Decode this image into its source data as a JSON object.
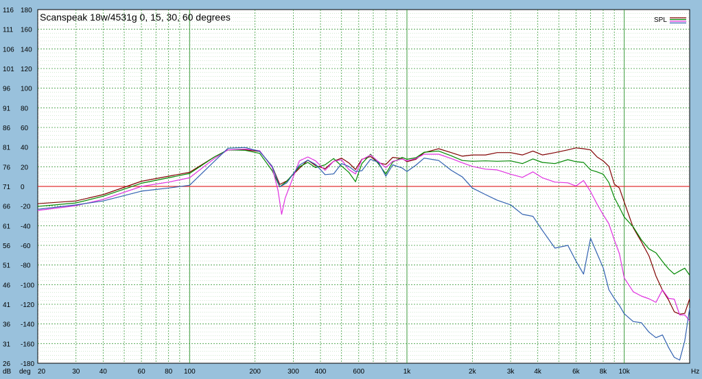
{
  "chart_data": {
    "type": "line",
    "title": "Scanspeak 18w/4531g 0, 15, 30, 60 degrees",
    "legend_label": "SPL",
    "legend_position": "top-right",
    "x_scale": "log",
    "xlim": [
      20,
      20000
    ],
    "x_unit": "Hz",
    "x_ticks": [
      {
        "v": 20,
        "label": "20"
      },
      {
        "v": 30,
        "label": "30"
      },
      {
        "v": 40,
        "label": "40"
      },
      {
        "v": 60,
        "label": "60"
      },
      {
        "v": 80,
        "label": "80"
      },
      {
        "v": 100,
        "label": "100"
      },
      {
        "v": 200,
        "label": "200"
      },
      {
        "v": 300,
        "label": "300"
      },
      {
        "v": 400,
        "label": "400"
      },
      {
        "v": 600,
        "label": "600"
      },
      {
        "v": 1000,
        "label": "1k"
      },
      {
        "v": 2000,
        "label": "2k"
      },
      {
        "v": 3000,
        "label": "3k"
      },
      {
        "v": 4000,
        "label": "4k"
      },
      {
        "v": 6000,
        "label": "6k"
      },
      {
        "v": 8000,
        "label": "8k"
      },
      {
        "v": 10000,
        "label": "10k"
      }
    ],
    "y_unit_db": "dB",
    "y_unit_deg": "deg",
    "ylim_db": [
      26,
      116
    ],
    "ylim_deg": [
      -180,
      180
    ],
    "y_ticks_db": [
      "116",
      "111",
      "106",
      "101",
      "96",
      "91",
      "86",
      "81",
      "76",
      "71",
      "66",
      "61",
      "56",
      "51",
      "46",
      "41",
      "36",
      "31",
      "26"
    ],
    "y_ticks_deg": [
      "180",
      "160",
      "140",
      "120",
      "100",
      "80",
      "60",
      "40",
      "20",
      "0",
      "-20",
      "-40",
      "-60",
      "-80",
      "-100",
      "-120",
      "-140",
      "-160",
      "-180"
    ],
    "grid": true,
    "colors": {
      "background": "#99c1dc",
      "plot_background": "#ffffff",
      "grid_major": "#3a9a3a",
      "grid_minor": "#9ed09e",
      "zero_line": "#e03030",
      "axis_text": "#000000"
    },
    "reference_line": {
      "deg": 0,
      "color": "#e03030"
    },
    "series": [
      {
        "color": "#800000",
        "points": [
          [
            20,
            66.6
          ],
          [
            30,
            67.3
          ],
          [
            40,
            68.9
          ],
          [
            60,
            72.3
          ],
          [
            80,
            73.6
          ],
          [
            100,
            74.6
          ],
          [
            130,
            78.5
          ],
          [
            150,
            80.3
          ],
          [
            180,
            80.3
          ],
          [
            210,
            79.9
          ],
          [
            240,
            76.1
          ],
          [
            260,
            71.5
          ],
          [
            280,
            72.4
          ],
          [
            320,
            75.6
          ],
          [
            350,
            77.7
          ],
          [
            380,
            76.3
          ],
          [
            420,
            75.5
          ],
          [
            460,
            77.4
          ],
          [
            500,
            78.2
          ],
          [
            540,
            77.0
          ],
          [
            580,
            75.3
          ],
          [
            620,
            77.9
          ],
          [
            680,
            78.6
          ],
          [
            740,
            77.0
          ],
          [
            800,
            76.6
          ],
          [
            860,
            78.4
          ],
          [
            950,
            78.1
          ],
          [
            1000,
            77.3
          ],
          [
            1100,
            77.9
          ],
          [
            1200,
            79.6
          ],
          [
            1400,
            80.6
          ],
          [
            1600,
            79.6
          ],
          [
            1800,
            78.7
          ],
          [
            2000,
            79.0
          ],
          [
            2300,
            79.0
          ],
          [
            2600,
            79.6
          ],
          [
            3000,
            79.6
          ],
          [
            3400,
            79.0
          ],
          [
            3800,
            80.0
          ],
          [
            4200,
            79.0
          ],
          [
            4800,
            79.6
          ],
          [
            5500,
            80.3
          ],
          [
            6000,
            80.8
          ],
          [
            6500,
            80.6
          ],
          [
            7000,
            80.3
          ],
          [
            7500,
            78.5
          ],
          [
            8000,
            77.5
          ],
          [
            8500,
            76.1
          ],
          [
            9000,
            71.6
          ],
          [
            9500,
            70.6
          ],
          [
            10000,
            67.0
          ],
          [
            11000,
            60.5
          ],
          [
            12000,
            56.9
          ],
          [
            13000,
            53.3
          ],
          [
            14000,
            48.2
          ],
          [
            15000,
            44.6
          ],
          [
            16000,
            42.1
          ],
          [
            17000,
            39.1
          ],
          [
            18000,
            38.5
          ],
          [
            19000,
            38.7
          ],
          [
            20000,
            42.4
          ]
        ]
      },
      {
        "color": "#008800",
        "points": [
          [
            20,
            65.9
          ],
          [
            30,
            66.8
          ],
          [
            40,
            68.5
          ],
          [
            60,
            71.8
          ],
          [
            80,
            73.2
          ],
          [
            100,
            74.3
          ],
          [
            130,
            78.5
          ],
          [
            150,
            80.3
          ],
          [
            180,
            80.2
          ],
          [
            210,
            79.4
          ],
          [
            240,
            75.0
          ],
          [
            260,
            70.9
          ],
          [
            280,
            72.3
          ],
          [
            320,
            76.0
          ],
          [
            350,
            77.1
          ],
          [
            380,
            75.8
          ],
          [
            420,
            76.5
          ],
          [
            460,
            78.1
          ],
          [
            500,
            76.2
          ],
          [
            540,
            74.6
          ],
          [
            580,
            72.2
          ],
          [
            620,
            76.8
          ],
          [
            680,
            79.2
          ],
          [
            740,
            76.7
          ],
          [
            800,
            74.2
          ],
          [
            860,
            77.2
          ],
          [
            950,
            78.4
          ],
          [
            1000,
            77.9
          ],
          [
            1100,
            78.3
          ],
          [
            1200,
            79.7
          ],
          [
            1400,
            80.0
          ],
          [
            1600,
            78.8
          ],
          [
            1800,
            77.6
          ],
          [
            2000,
            77.4
          ],
          [
            2300,
            77.5
          ],
          [
            2600,
            77.4
          ],
          [
            3000,
            77.5
          ],
          [
            3400,
            76.8
          ],
          [
            3800,
            78.0
          ],
          [
            4200,
            77.1
          ],
          [
            4800,
            76.8
          ],
          [
            5500,
            77.8
          ],
          [
            6000,
            77.3
          ],
          [
            6500,
            77.1
          ],
          [
            7000,
            75.2
          ],
          [
            7500,
            74.7
          ],
          [
            8000,
            74.1
          ],
          [
            8500,
            72.0
          ],
          [
            9000,
            68.2
          ],
          [
            9500,
            65.7
          ],
          [
            10000,
            63.2
          ],
          [
            11000,
            60.7
          ],
          [
            12000,
            57.4
          ],
          [
            13000,
            55.1
          ],
          [
            14000,
            54.1
          ],
          [
            15000,
            51.9
          ],
          [
            16000,
            50.0
          ],
          [
            17000,
            48.7
          ],
          [
            18000,
            49.5
          ],
          [
            19000,
            50.2
          ],
          [
            20000,
            48.4
          ]
        ]
      },
      {
        "color": "#e030e0",
        "points": [
          [
            20,
            64.9
          ],
          [
            30,
            66.1
          ],
          [
            40,
            67.7
          ],
          [
            60,
            71.0
          ],
          [
            80,
            72.1
          ],
          [
            100,
            73.2
          ],
          [
            130,
            78.1
          ],
          [
            150,
            80.3
          ],
          [
            180,
            80.5
          ],
          [
            210,
            80.1
          ],
          [
            240,
            75.8
          ],
          [
            255,
            70.0
          ],
          [
            265,
            63.9
          ],
          [
            275,
            68.0
          ],
          [
            320,
            77.5
          ],
          [
            350,
            78.5
          ],
          [
            380,
            77.5
          ],
          [
            420,
            75.1
          ],
          [
            460,
            77.4
          ],
          [
            500,
            77.8
          ],
          [
            540,
            75.3
          ],
          [
            580,
            74.2
          ],
          [
            620,
            77.8
          ],
          [
            680,
            79.0
          ],
          [
            740,
            77.3
          ],
          [
            800,
            75.8
          ],
          [
            860,
            77.4
          ],
          [
            950,
            78.0
          ],
          [
            1000,
            77.5
          ],
          [
            1100,
            78.1
          ],
          [
            1200,
            79.2
          ],
          [
            1400,
            79.2
          ],
          [
            1600,
            78.1
          ],
          [
            1800,
            77.0
          ],
          [
            2000,
            76.1
          ],
          [
            2300,
            75.4
          ],
          [
            2600,
            75.2
          ],
          [
            3000,
            74.1
          ],
          [
            3400,
            73.3
          ],
          [
            3800,
            74.7
          ],
          [
            4200,
            73.2
          ],
          [
            4800,
            72.1
          ],
          [
            5500,
            71.9
          ],
          [
            6000,
            71.1
          ],
          [
            6500,
            72.5
          ],
          [
            7000,
            69.7
          ],
          [
            7500,
            66.5
          ],
          [
            8000,
            63.8
          ],
          [
            8500,
            61.5
          ],
          [
            9000,
            57.4
          ],
          [
            9500,
            53.9
          ],
          [
            10000,
            47.7
          ],
          [
            11000,
            44.2
          ],
          [
            12000,
            43.1
          ],
          [
            13000,
            42.4
          ],
          [
            14000,
            41.5
          ],
          [
            15000,
            44.7
          ],
          [
            16000,
            42.5
          ],
          [
            17000,
            42.3
          ],
          [
            18000,
            38.3
          ],
          [
            19000,
            38.3
          ],
          [
            20000,
            36.8
          ]
        ]
      },
      {
        "color": "#3060b0",
        "points": [
          [
            20,
            65.2
          ],
          [
            30,
            66.3
          ],
          [
            40,
            67.3
          ],
          [
            60,
            69.8
          ],
          [
            80,
            70.6
          ],
          [
            100,
            71.3
          ],
          [
            130,
            77.4
          ],
          [
            150,
            80.7
          ],
          [
            180,
            80.9
          ],
          [
            210,
            79.9
          ],
          [
            240,
            76.1
          ],
          [
            260,
            70.9
          ],
          [
            280,
            71.9
          ],
          [
            320,
            76.4
          ],
          [
            350,
            77.7
          ],
          [
            380,
            76.6
          ],
          [
            420,
            74.0
          ],
          [
            460,
            74.2
          ],
          [
            500,
            76.8
          ],
          [
            540,
            76.1
          ],
          [
            580,
            74.8
          ],
          [
            620,
            75.0
          ],
          [
            680,
            77.9
          ],
          [
            740,
            77.1
          ],
          [
            800,
            73.6
          ],
          [
            860,
            76.5
          ],
          [
            950,
            75.7
          ],
          [
            1000,
            74.8
          ],
          [
            1100,
            76.4
          ],
          [
            1200,
            78.2
          ],
          [
            1400,
            77.6
          ],
          [
            1600,
            75.1
          ],
          [
            1800,
            73.4
          ],
          [
            2000,
            70.6
          ],
          [
            2300,
            68.9
          ],
          [
            2600,
            67.5
          ],
          [
            3000,
            66.3
          ],
          [
            3400,
            63.9
          ],
          [
            3800,
            63.4
          ],
          [
            4200,
            59.8
          ],
          [
            4800,
            55.3
          ],
          [
            5500,
            56.0
          ],
          [
            6000,
            52.0
          ],
          [
            6500,
            48.7
          ],
          [
            7000,
            57.8
          ],
          [
            7500,
            53.9
          ],
          [
            8000,
            50.3
          ],
          [
            8500,
            44.7
          ],
          [
            9000,
            42.5
          ],
          [
            9500,
            40.7
          ],
          [
            10000,
            38.6
          ],
          [
            11000,
            36.6
          ],
          [
            12000,
            36.3
          ],
          [
            13000,
            33.9
          ],
          [
            14000,
            32.5
          ],
          [
            15000,
            33.2
          ],
          [
            16000,
            30.0
          ],
          [
            17000,
            27.5
          ],
          [
            18000,
            26.8
          ],
          [
            19000,
            31.7
          ],
          [
            20000,
            40.0
          ]
        ]
      }
    ]
  }
}
